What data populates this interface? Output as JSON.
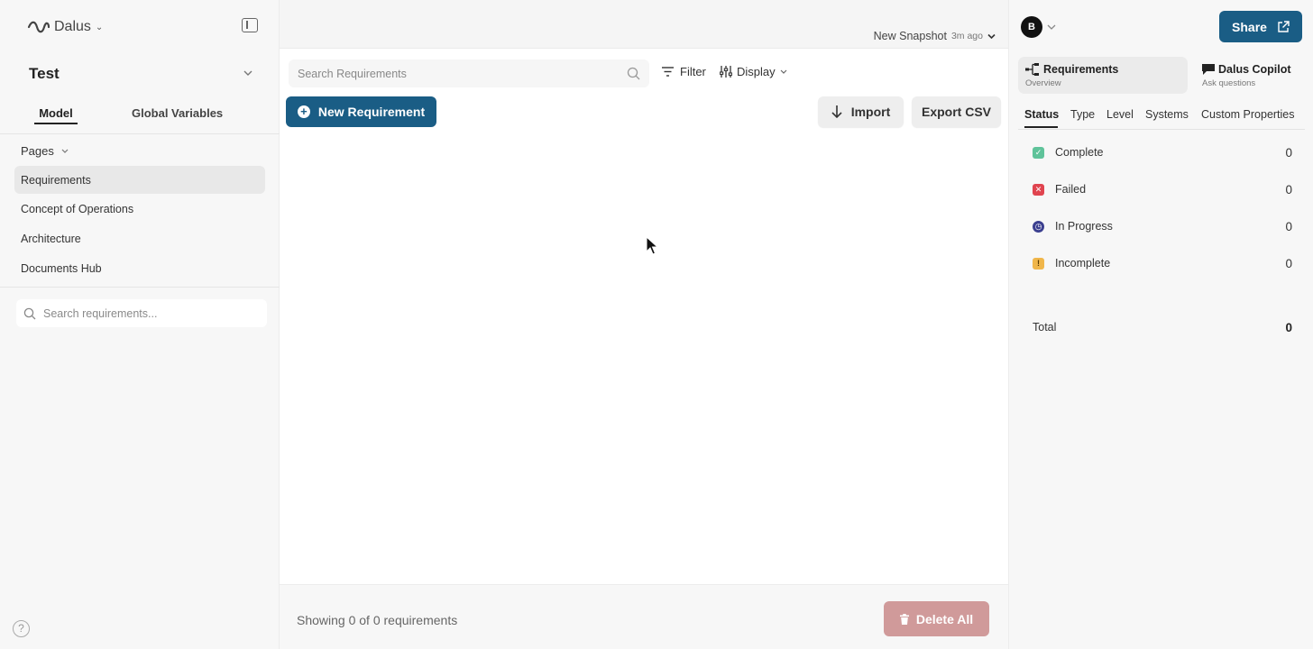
{
  "sidebar": {
    "brand": "Dalus",
    "project_name": "Test",
    "tabs": {
      "model": "Model",
      "global_variables": "Global Variables"
    },
    "pages_label": "Pages",
    "items": [
      {
        "label": "Requirements",
        "active": true
      },
      {
        "label": "Concept of Operations",
        "active": false
      },
      {
        "label": "Architecture",
        "active": false
      },
      {
        "label": "Documents Hub",
        "active": false
      }
    ],
    "search_placeholder": "Search requirements...",
    "help_label": "?"
  },
  "topbar": {
    "snapshot_label": "New Snapshot",
    "snapshot_time": "3m ago"
  },
  "toolbar": {
    "search_placeholder": "Search Requirements",
    "filter_label": "Filter",
    "display_label": "Display",
    "new_requirement_label": "New Requirement",
    "import_label": "Import",
    "export_label": "Export CSV"
  },
  "footer": {
    "showing_text": "Showing 0 of 0 requirements",
    "delete_all_label": "Delete All"
  },
  "right_panel": {
    "avatar_initial": "B",
    "share_label": "Share",
    "cards": {
      "requirements": {
        "title": "Requirements",
        "subtitle": "Overview"
      },
      "copilot": {
        "title": "Dalus Copilot",
        "subtitle": "Ask questions"
      }
    },
    "tabs": [
      "Status",
      "Type",
      "Level",
      "Systems",
      "Custom Properties"
    ],
    "statuses": [
      {
        "label": "Complete",
        "count": "0",
        "color": "#5fc39a"
      },
      {
        "label": "Failed",
        "count": "0",
        "color": "#e0444f"
      },
      {
        "label": "In Progress",
        "count": "0",
        "color": "#3b3f8f"
      },
      {
        "label": "Incomplete",
        "count": "0",
        "color": "#f0b64a"
      }
    ],
    "total_label": "Total",
    "total_count": "0"
  },
  "colors": {
    "accent": "#1a5d85",
    "danger_muted": "#d09a9a"
  }
}
